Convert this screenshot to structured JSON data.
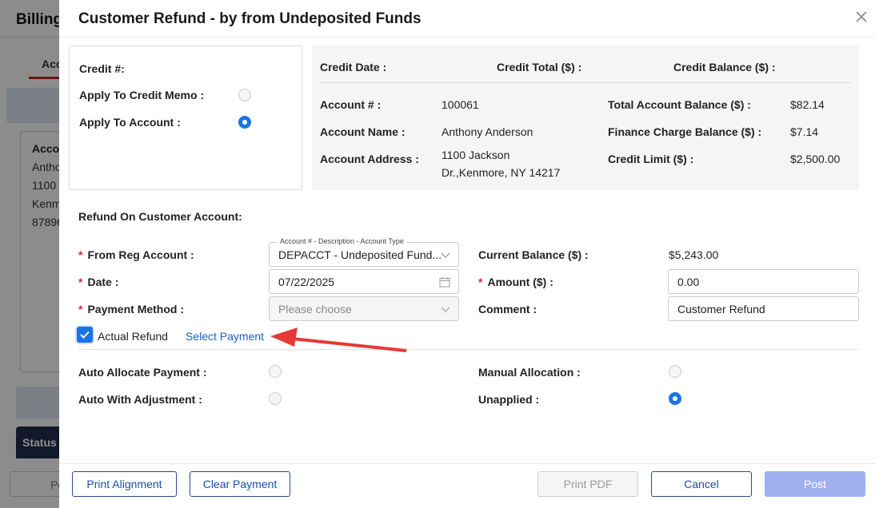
{
  "background": {
    "title": "Billing",
    "tab": "Acc",
    "card_heading": "Accou",
    "card_lines": [
      "Antho",
      "1100",
      "Kenm",
      "87896"
    ],
    "status_label": "Status",
    "po_button": "Po"
  },
  "modal": {
    "title": "Customer Refund - by from Undeposited Funds",
    "credit": {
      "credit_number_label": "Credit #:",
      "apply_credit_memo_label": "Apply To Credit Memo :",
      "apply_account_label": "Apply To Account :"
    },
    "info": {
      "credit_date_label": "Credit Date :",
      "credit_total_label": "Credit Total ($) :",
      "credit_balance_label": "Credit Balance ($) :",
      "account_number_label": "Account # :",
      "account_number": "100061",
      "account_name_label": "Account Name :",
      "account_name": "Anthony Anderson",
      "account_address_label": "Account Address :",
      "account_address_line1": "1100 Jackson",
      "account_address_line2": "Dr.,Kenmore, NY 14217",
      "total_account_balance_label": "Total Account Balance ($) :",
      "total_account_balance": "$82.14",
      "finance_charge_balance_label": "Finance Charge Balance ($) :",
      "finance_charge_balance": "$7.14",
      "credit_limit_label": "Credit Limit ($) :",
      "credit_limit": "$2,500.00"
    },
    "refund": {
      "section_label": "Refund On Customer Account:",
      "from_reg_account_label": "From Reg Account :",
      "from_reg_account_legend": "Account # - Description - Account Type",
      "from_reg_account_value": "DEPACCT - Undeposited Fund...",
      "date_label": "Date :",
      "date_value": "07/22/2025",
      "payment_method_label": "Payment Method :",
      "payment_method_placeholder": "Please choose",
      "current_balance_label": "Current Balance ($) :",
      "current_balance": "$5,243.00",
      "amount_label": "Amount ($) :",
      "amount_value": "0.00",
      "comment_label": "Comment :",
      "comment_value": "Customer Refund",
      "actual_refund_label": "Actual Refund",
      "select_payment_link": "Select Payment",
      "required_marker": "*"
    },
    "allocation": {
      "auto_allocate_label": "Auto Allocate Payment :",
      "auto_adjustment_label": "Auto With Adjustment :",
      "manual_allocation_label": "Manual Allocation :",
      "unapplied_label": "Unapplied :"
    },
    "footer": {
      "print_alignment": "Print Alignment",
      "clear_payment": "Clear Payment",
      "print_pdf": "Print PDF",
      "cancel": "Cancel",
      "post": "Post"
    }
  },
  "colors": {
    "accent": "#1a73e8",
    "required": "#d32f2f",
    "arrow": "#e53935",
    "post_button": "#9fb0ee"
  }
}
